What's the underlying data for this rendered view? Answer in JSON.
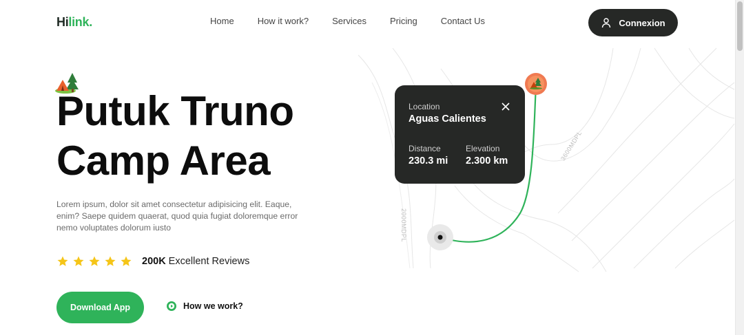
{
  "header": {
    "logo_primary": "Hi",
    "logo_accent": "link.",
    "nav": [
      {
        "label": "Home"
      },
      {
        "label": "How it work?"
      },
      {
        "label": "Services"
      },
      {
        "label": "Pricing"
      },
      {
        "label": "Contact Us"
      }
    ],
    "login_label": "Connexion"
  },
  "hero": {
    "title_line1": "Putuk Truno",
    "title_line2": "Camp Area",
    "description": "Lorem ipsum, dolor sit amet consectetur adipisicing elit. Eaque, enim? Saepe quidem quaerat, quod quia fugiat doloremque error nemo voluptates dolorum iusto",
    "rating": {
      "stars": 5,
      "count": "200K",
      "label": "Excellent Reviews"
    },
    "download_label": "Download App",
    "how_label": "How we work?"
  },
  "map_card": {
    "location_label": "Location",
    "location_value": "Aguas Calientes",
    "distance_label": "Distance",
    "distance_value": "230.3 mi",
    "elevation_label": "Elevation",
    "elevation_value": "2.300 km"
  },
  "map": {
    "contour_label_1": "3600MDPL",
    "contour_label_2": "2000MDPL"
  },
  "colors": {
    "accent": "#2fb35a",
    "dark": "#262826",
    "star": "#f5c518",
    "pin": "#f07a52"
  },
  "icons": {
    "login": "user-icon",
    "close": "close-icon",
    "star": "star-icon",
    "play": "play-circle-icon",
    "tent": "tent-icon",
    "start": "start-point-icon"
  }
}
